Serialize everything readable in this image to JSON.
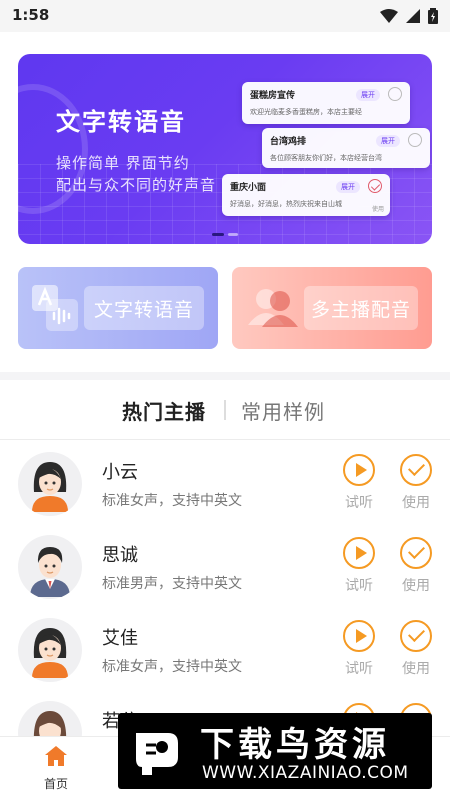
{
  "status_bar": {
    "time": "1:58"
  },
  "banner": {
    "title": "文字转语音",
    "subtitle_1": "操作简单 界面节约",
    "subtitle_2": "配出与众不同的好声音",
    "cards": [
      {
        "title": "蛋糕房宣传",
        "desc": "欢迎光临麦多香蛋糕房，本店主要经",
        "tag": "展开"
      },
      {
        "title": "台湾鸡排",
        "desc": "各位顾客朋友你们好，本店经营台湾",
        "tag": "展开"
      },
      {
        "title": "重庆小面",
        "desc": "好消息，好消息，热烈庆祝来自山城",
        "tag": "展开",
        "used": "使用"
      }
    ]
  },
  "features": [
    {
      "label": "文字转语音",
      "icon": "text-to-speech-icon"
    },
    {
      "label": "多主播配音",
      "icon": "multi-anchor-icon"
    }
  ],
  "tabs": [
    {
      "label": "热门主播",
      "active": true
    },
    {
      "label": "常用样例",
      "active": false
    }
  ],
  "voices": [
    {
      "name": "小云",
      "desc": "标准女声，支持中英文",
      "gender": "female",
      "play_label": "试听",
      "use_label": "使用"
    },
    {
      "name": "思诚",
      "desc": "标准男声，支持中英文",
      "gender": "male",
      "play_label": "试听",
      "use_label": "使用"
    },
    {
      "name": "艾佳",
      "desc": "标准女声，支持中英文",
      "gender": "female",
      "play_label": "试听",
      "use_label": "使用"
    },
    {
      "name": "若兮",
      "desc": "",
      "gender": "female",
      "play_label": "",
      "use_label": ""
    }
  ],
  "bottom_nav": [
    {
      "label": "首页",
      "icon": "home-icon",
      "active": true
    },
    {
      "label": "",
      "icon": "samples-icon",
      "active": false
    },
    {
      "label": "",
      "icon": "anchor-icon",
      "active": false
    },
    {
      "label": "",
      "icon": "profile-icon",
      "active": false
    }
  ],
  "watermark": {
    "text": "下载鸟资源",
    "url": "WWW.XIAZAINIAO.COM"
  },
  "colors": {
    "accent": "#f59a23",
    "banner": "#6a3cf2",
    "home": "#f07a2a"
  }
}
